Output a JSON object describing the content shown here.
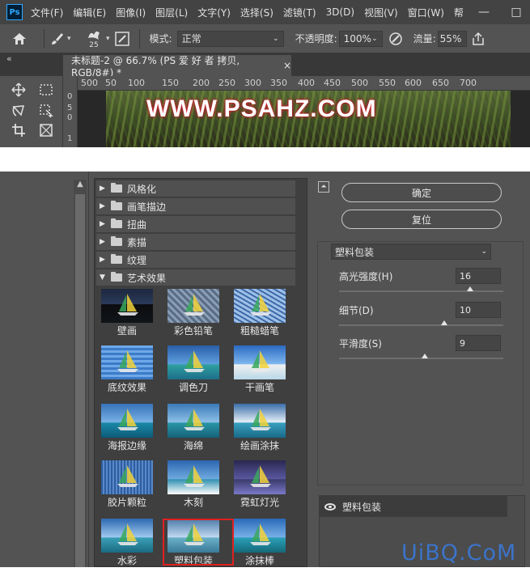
{
  "menubar": {
    "logo": "Ps",
    "items": [
      "文件(F)",
      "编辑(E)",
      "图像(I)",
      "图层(L)",
      "文字(Y)",
      "选择(S)",
      "滤镜(T)",
      "3D(D)",
      "视图(V)",
      "窗口(W)",
      "帮"
    ],
    "minimize": "—",
    "restore": "□"
  },
  "options": {
    "brush_size": "25",
    "mode_label": "模式:",
    "mode_value": "正常",
    "opacity_label": "不透明度:",
    "opacity_value": "100%",
    "flow_label": "流量:",
    "flow_value": "55%"
  },
  "document": {
    "collapse": "«",
    "tab_title": "未标题-2 @ 66.7% (PS 爱 好 者 拷贝, RGB/8#) *",
    "close": "×",
    "ruler_ticks": [
      "500",
      "50",
      "100",
      "150",
      "200",
      "250",
      "300",
      "350",
      "400",
      "450",
      "500",
      "550",
      "600",
      "650",
      "700"
    ],
    "ruler_v_ticks": [
      "0",
      "5",
      "0",
      "1"
    ],
    "watermark": "WWW.PSAHZ.COM"
  },
  "gallery": {
    "categories": [
      "风格化",
      "画笔描边",
      "扭曲",
      "素描",
      "纹理",
      "艺术效果"
    ],
    "thumbnails": [
      "壁画",
      "彩色铅笔",
      "粗糙蜡笔",
      "底纹效果",
      "调色刀",
      "干画笔",
      "海报边缘",
      "海绵",
      "绘画涂抹",
      "胶片颗粒",
      "木刻",
      "霓虹灯光",
      "水彩",
      "塑料包装",
      "涂抹棒"
    ]
  },
  "controls": {
    "collapse": "⏶",
    "ok": "确定",
    "reset": "复位",
    "filter_name": "塑料包装",
    "params": [
      {
        "label": "高光强度(H)",
        "value": "16",
        "fraction": 0.8
      },
      {
        "label": "细节(D)",
        "value": "10",
        "fraction": 0.64
      },
      {
        "label": "平滑度(S)",
        "value": "9",
        "fraction": 0.52
      }
    ],
    "layer_name": "塑料包装"
  },
  "site_logo": "UiBQ.CoM"
}
